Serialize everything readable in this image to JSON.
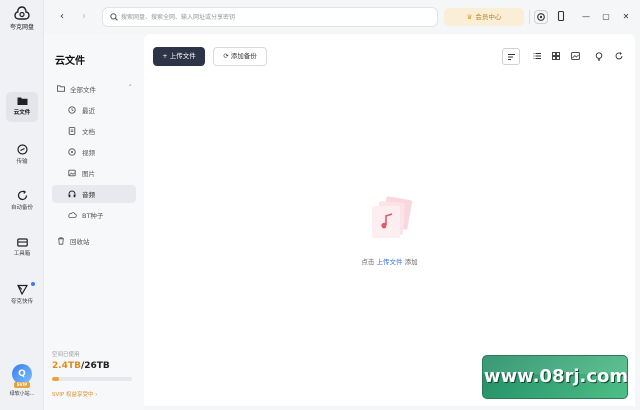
{
  "app": {
    "logo_text": "夸克网盘"
  },
  "rail": {
    "items": [
      {
        "label": "云文件",
        "icon": "folder-icon",
        "active": true
      },
      {
        "label": "传输",
        "icon": "transfer-icon",
        "active": false
      },
      {
        "label": "自动备份",
        "icon": "backup-icon",
        "active": false
      },
      {
        "label": "工具箱",
        "icon": "toolbox-icon",
        "active": false
      },
      {
        "label": "夸克快传",
        "icon": "send-icon",
        "active": false
      }
    ],
    "user": {
      "avatar_letter": "Q",
      "badge": "SVIP",
      "name": "绿软小站..."
    }
  },
  "topbar": {
    "search_placeholder": "搜索网盘、搜索全网、输入网址或分享密钥",
    "vip_label": "会员中心",
    "window_controls": [
      "—",
      "▢",
      "✕"
    ]
  },
  "panel": {
    "title": "云文件",
    "tree": [
      {
        "label": "全部文件",
        "icon": "folder-outline-icon",
        "level": 0
      },
      {
        "label": "最近",
        "icon": "clock-icon",
        "level": 1
      },
      {
        "label": "文档",
        "icon": "document-icon",
        "level": 1
      },
      {
        "label": "视频",
        "icon": "video-icon",
        "level": 1
      },
      {
        "label": "图片",
        "icon": "image-icon",
        "level": 1
      },
      {
        "label": "音频",
        "icon": "headphones-icon",
        "level": 1,
        "active": true
      },
      {
        "label": "BT种子",
        "icon": "bt-icon",
        "level": 1
      },
      {
        "label": "回收站",
        "icon": "trash-icon",
        "level": 0
      }
    ],
    "storage": {
      "label": "空间已使用",
      "used": "2.4TB",
      "separator": "/",
      "total": "26TB",
      "fraction": 0.092
    },
    "svip_promo": "SVIP 权益享受中 ›"
  },
  "main": {
    "upload_label": "上传文件",
    "backup_label": "添加备份",
    "empty": {
      "prefix": "点击 ",
      "link": "上传文件",
      "suffix": " 添加"
    }
  },
  "watermark": {
    "text": "www.08rj.com"
  },
  "colors": {
    "accent": "#2d3447",
    "link": "#2f6fe0",
    "vip": "#e39a24",
    "storage_fill": "#f0a23a"
  }
}
